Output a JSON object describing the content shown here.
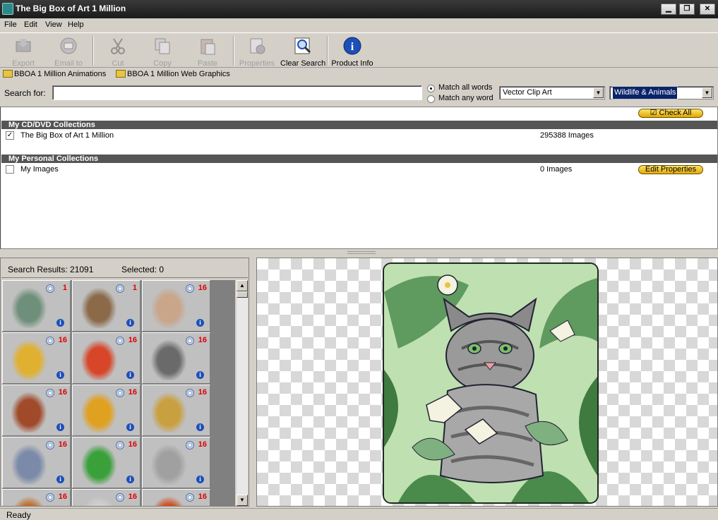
{
  "window": {
    "title": "The Big Box of Art 1 Million",
    "min": "▁",
    "max": "❐",
    "close": "✕"
  },
  "menu": [
    "File",
    "Edit",
    "View",
    "Help"
  ],
  "toolbar": [
    {
      "label": "Export",
      "icon": "export-icon",
      "enabled": false
    },
    {
      "label": "Email to",
      "icon": "email-icon",
      "enabled": false
    },
    {
      "label": "Cut",
      "icon": "cut-icon",
      "enabled": false
    },
    {
      "label": "Copy",
      "icon": "copy-icon",
      "enabled": false
    },
    {
      "label": "Paste",
      "icon": "paste-icon",
      "enabled": false
    },
    {
      "label": "Properties",
      "icon": "properties-icon",
      "enabled": false
    },
    {
      "label": "Clear Search",
      "icon": "clear-search-icon",
      "enabled": true
    },
    {
      "label": "Product Info",
      "icon": "info-icon",
      "enabled": true
    }
  ],
  "favorites": [
    "BBOA 1 Million Animations",
    "BBOA 1 Million Web Graphics"
  ],
  "search": {
    "label": "Search for:",
    "value": "",
    "match_all": "Match all words",
    "match_any": "Match any word",
    "match_mode": "all",
    "type": "Vector Clip Art",
    "category": "Wildlife & Animals"
  },
  "collections": {
    "check_all": "Check All",
    "check_all_mark": "☑",
    "cd_header": "My CD/DVD Collections",
    "cd_items": [
      {
        "name": "The Big Box of Art 1 Million",
        "count": "295388 Images",
        "checked": true,
        "mark": "✓"
      }
    ],
    "personal_header": "My Personal Collections",
    "personal_items": [
      {
        "name": "My Images",
        "count": "0 Images",
        "checked": false
      }
    ],
    "edit_properties": "Edit Properties"
  },
  "results": {
    "count_text": "Search Results: 21091",
    "selected_text": "Selected: 0",
    "thumbnails": [
      {
        "subject": "lynx-photo",
        "count": "1"
      },
      {
        "subject": "hippo",
        "count": "1"
      },
      {
        "subject": "horse",
        "count": "16"
      },
      {
        "subject": "lion",
        "count": "16"
      },
      {
        "subject": "rooster",
        "count": "16"
      },
      {
        "subject": "zebra",
        "count": "16"
      },
      {
        "subject": "bull",
        "count": "16"
      },
      {
        "subject": "tiger",
        "count": "16"
      },
      {
        "subject": "snail",
        "count": "16"
      },
      {
        "subject": "shark",
        "count": "16"
      },
      {
        "subject": "dragon",
        "count": "16"
      },
      {
        "subject": "heron",
        "count": "16"
      },
      {
        "subject": "bird",
        "count": "16"
      },
      {
        "subject": "mouse",
        "count": "16"
      },
      {
        "subject": "fish",
        "count": "16"
      }
    ],
    "info_glyph": "i",
    "scroll_up": "▲",
    "scroll_down": "▼"
  },
  "preview": {
    "subject": "cat-in-foliage"
  },
  "status": "Ready"
}
